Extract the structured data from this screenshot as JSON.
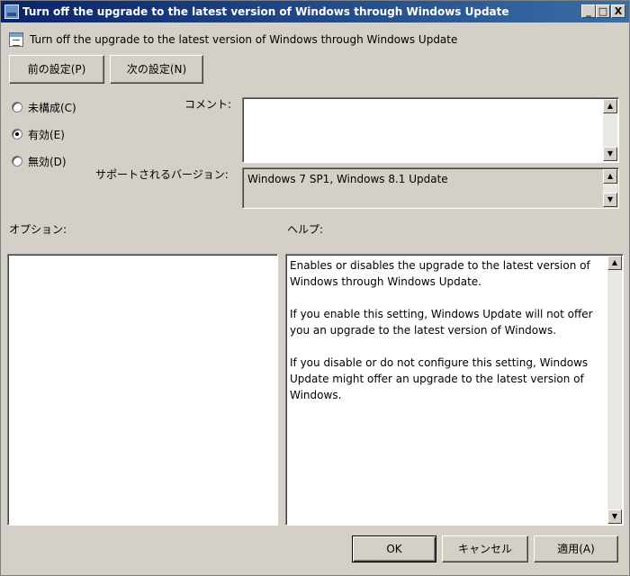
{
  "window": {
    "title": "Turn off the upgrade to the latest version of Windows through Windows Update",
    "controls": {
      "minimize": "_",
      "maximize": "□",
      "close": "X"
    }
  },
  "policy": {
    "title": "Turn off the upgrade to the latest version of Windows through Windows Update"
  },
  "nav": {
    "prev_label": "前の設定(P)",
    "next_label": "次の設定(N)"
  },
  "state": {
    "options": [
      {
        "label": "未構成(C)",
        "checked": false
      },
      {
        "label": "有効(E)",
        "checked": true
      },
      {
        "label": "無効(D)",
        "checked": false
      }
    ]
  },
  "comment": {
    "label": "コメント:",
    "value": ""
  },
  "supported": {
    "label": "サポートされるバージョン:",
    "value": "Windows 7 SP1, Windows 8.1 Update"
  },
  "options_panel": {
    "label": "オプション:"
  },
  "help_panel": {
    "label": "ヘルプ:",
    "paragraphs": [
      "Enables or disables the upgrade to the latest version of Windows through Windows Update.",
      "If you enable this setting, Windows Update will not offer you an upgrade to the latest version of Windows.",
      "If you disable or do not configure this setting, Windows Update might offer an upgrade to the latest version of Windows."
    ]
  },
  "footer": {
    "ok_label": "OK",
    "cancel_label": "キャンセル",
    "apply_label": "適用(A)"
  },
  "icons": {
    "window": "window-app-icon",
    "policy": "policy-setting-icon",
    "scroll_up": "▲",
    "scroll_down": "▼"
  }
}
